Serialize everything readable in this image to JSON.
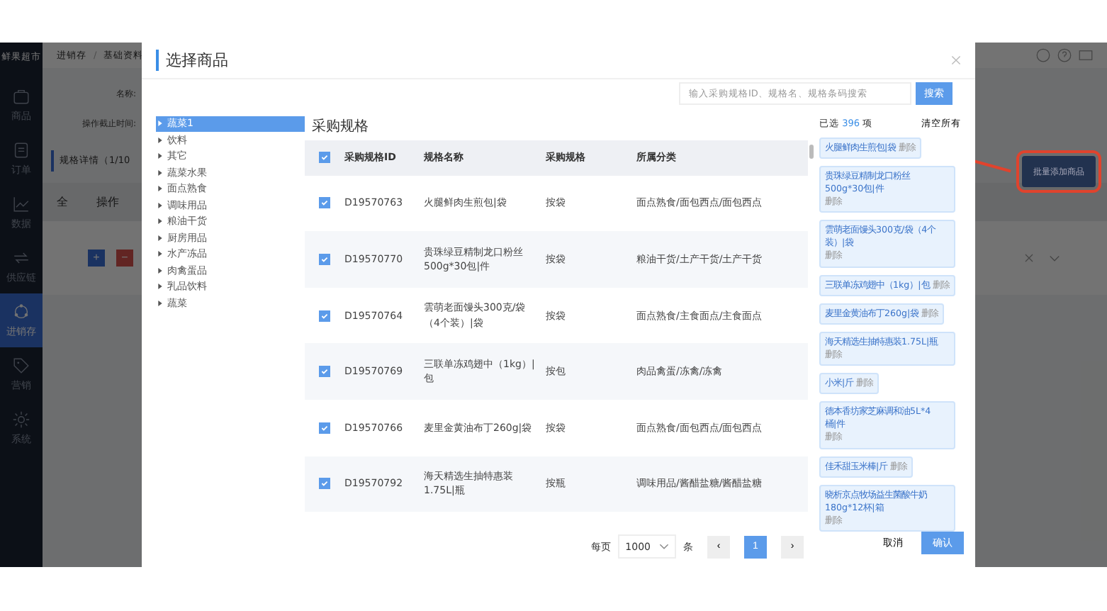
{
  "app": {
    "brand": "鲜果超市",
    "breadcrumbs": [
      "进销存",
      "基础资料"
    ],
    "breadcrumb_separator": "/",
    "nav": [
      {
        "label": "商品",
        "selected": false
      },
      {
        "label": "订单",
        "selected": false
      },
      {
        "label": "数据",
        "selected": false
      },
      {
        "label": "供应链",
        "selected": false
      },
      {
        "label": "进销存",
        "selected": true
      },
      {
        "label": "营销",
        "selected": false
      },
      {
        "label": "系统",
        "selected": false
      }
    ],
    "filters": [
      "名称:",
      "操作截止时间:"
    ],
    "section_title": "规格详情（1/10",
    "table_header": [
      "全",
      "操作"
    ],
    "row_buttons": [
      "+",
      "−"
    ],
    "bulk_add_button": "批量添加商品",
    "highlight_bulk_add": true
  },
  "dialog": {
    "title": "选择商品",
    "search": {
      "placeholder": "输入采购规格ID、规格名、规格条码搜索",
      "button": "搜索"
    },
    "categories": [
      {
        "label": "蔬菜1",
        "selected": true
      },
      {
        "label": "饮料",
        "selected": false
      },
      {
        "label": "其它",
        "selected": false
      },
      {
        "label": "蔬菜水果",
        "selected": false
      },
      {
        "label": "面点熟食",
        "selected": false
      },
      {
        "label": "调味用品",
        "selected": false
      },
      {
        "label": "粮油干货",
        "selected": false
      },
      {
        "label": "厨房用品",
        "selected": false
      },
      {
        "label": "水产冻品",
        "selected": false
      },
      {
        "label": "肉禽蛋品",
        "selected": false
      },
      {
        "label": "乳品饮料",
        "selected": false
      },
      {
        "label": "蔬菜",
        "selected": false
      }
    ],
    "table": {
      "title": "采购规格",
      "all_checked": true,
      "columns": [
        "采购规格ID",
        "规格名称",
        "采购规格",
        "所属分类"
      ],
      "rows": [
        {
          "checked": true,
          "id": "D19570763",
          "name": "火腿鲜肉生煎包|袋",
          "spec": "按袋",
          "category": "面点熟食/面包西点/面包西点"
        },
        {
          "checked": true,
          "id": "D19570770",
          "name": "贵珠绿豆精制龙口粉丝500g*30包|件",
          "spec": "按袋",
          "category": "粮油干货/土产干货/土产干货"
        },
        {
          "checked": true,
          "id": "D19570764",
          "name": "雲萌老面馒头300克/袋（4个装）|袋",
          "spec": "按袋",
          "category": "面点熟食/主食面点/主食面点"
        },
        {
          "checked": true,
          "id": "D19570769",
          "name": "三联单冻鸡翅中（1kg）|包",
          "spec": "按包",
          "category": "肉品禽蛋/冻禽/冻禽"
        },
        {
          "checked": true,
          "id": "D19570766",
          "name": "麦里金黄油布丁260g|袋",
          "spec": "按袋",
          "category": "面点熟食/面包西点/面包西点"
        },
        {
          "checked": true,
          "id": "D19570792",
          "name": "海天精选生抽特惠装1.75L|瓶",
          "spec": "按瓶",
          "category": "调味用品/酱醋盐糖/酱醋盐糖"
        }
      ]
    },
    "pagination": {
      "per_page_label": "每页",
      "page_size": "1000",
      "unit": "条",
      "prev": "‹",
      "pages": [
        {
          "label": "1",
          "selected": true
        }
      ],
      "next": "›"
    },
    "selected_panel": {
      "count_prefix": "已选",
      "count": "396",
      "count_suffix": "项",
      "clear_button": "清空所有",
      "items": [
        {
          "label": "火腿鲜肉生煎包|袋",
          "remove": "删除"
        },
        {
          "label": "贵珠绿豆精制龙口粉丝500g*30包|件",
          "remove": "删除"
        },
        {
          "label": "雲萌老面馒头300克/袋（4个装）|袋",
          "remove": "删除"
        },
        {
          "label": "三联单冻鸡翅中（1kg）|包",
          "remove": "删除"
        },
        {
          "label": "麦里金黄油布丁260g|袋",
          "remove": "删除"
        },
        {
          "label": "海天精选生抽特惠装1.75L|瓶",
          "remove": "删除"
        },
        {
          "label": "小米|斤",
          "remove": "删除"
        },
        {
          "label": "德本香坊家芝麻调和油5L*4桶|件",
          "remove": "删除"
        },
        {
          "label": "佳禾甜玉米棒|斤",
          "remove": "删除"
        },
        {
          "label": "晓析京点牧场益生菌酸牛奶180g*12杯|箱",
          "remove": "删除"
        }
      ]
    },
    "buttons": {
      "cancel": "取消",
      "confirm": "确认"
    }
  }
}
